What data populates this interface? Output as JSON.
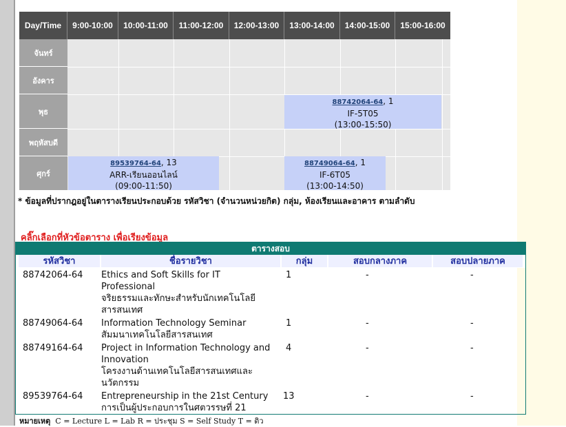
{
  "timetable": {
    "header": [
      "Day/Time",
      "9:00-10:00",
      "10:00-11:00",
      "11:00-12:00",
      "12:00-13:00",
      "13:00-14:00",
      "14:00-15:00",
      "15:00-16:00"
    ],
    "days": [
      "จันทร์",
      "อังคาร",
      "พุธ",
      "พฤหัสบดี",
      "ศุกร์"
    ],
    "courses": [
      {
        "code": "88742064-64",
        "group": ", 1",
        "room": "IF-5T05",
        "time": "(13:00-15:50)"
      },
      {
        "code": "89539764-64",
        "group": ", 13",
        "room": "ARR-เรียนออนไลน์",
        "time": "(09:00-11:50)"
      },
      {
        "code": "88749064-64",
        "group": ", 1",
        "room": "IF-6T05",
        "time": "(13:00-14:50)"
      }
    ]
  },
  "note": "* ข้อมูลที่ปรากฎอยู่ในตารางเรียนประกอบด้วย รหัสวิชา (จำนวนหน่วยกิต) กลุ่ม, ห้องเรียนและอาคาร ตามลำดับ",
  "sort_hint": "คลิ๊กเลือกที่หัวข้อตาราง เพื่อเรียงข้อมูล",
  "exam": {
    "title": "ตารางสอบ",
    "columns": [
      "รหัสวิชา",
      "ชื่อรายวิชา",
      "กลุ่ม",
      "สอบกลางภาค",
      "สอบปลายภาค"
    ],
    "rows": [
      {
        "code": "88742064-64",
        "name_en1": "Ethics and Soft Skills for IT",
        "name_en2": "Professional",
        "name_th1": "จริยธรรมและทักษะสำหรับนักเทคโนโลยี",
        "name_th2": "สารสนเทศ",
        "group": "1",
        "mid": "-",
        "final": "-"
      },
      {
        "code": "88749064-64",
        "name_en1": "Information Technology Seminar",
        "name_en2": "",
        "name_th1": "สัมมนาเทคโนโลยีสารสนเทศ",
        "name_th2": "",
        "group": "1",
        "mid": "-",
        "final": "-"
      },
      {
        "code": "88749164-64",
        "name_en1": "Project in Information Technology and",
        "name_en2": "Innovation",
        "name_th1": "โครงงานด้านเทคโนโลยีสารสนเทศและ",
        "name_th2": "นวัตกรรม",
        "group": "4",
        "mid": "-",
        "final": "-"
      },
      {
        "code": "89539764-64",
        "name_en1": "Entrepreneurship in the 21st Century",
        "name_en2": "",
        "name_th1": "การเป็นผู้ประกอบการในศตวรรษที่ 21",
        "name_th2": "",
        "group": "13",
        "mid": "-",
        "final": "-"
      }
    ]
  },
  "legend": {
    "label": "หมายเหตุ",
    "text": "C = Lecture  L = Lab  R = ประชุม  S = Self Study  T = ติว"
  },
  "colors": {
    "header_bg": "#4d4d4d",
    "day_bg": "#a3a3a3",
    "course_bg": "#c6d1f8",
    "exam_title_bg": "#0f7a72",
    "hint_red": "#e02020"
  }
}
